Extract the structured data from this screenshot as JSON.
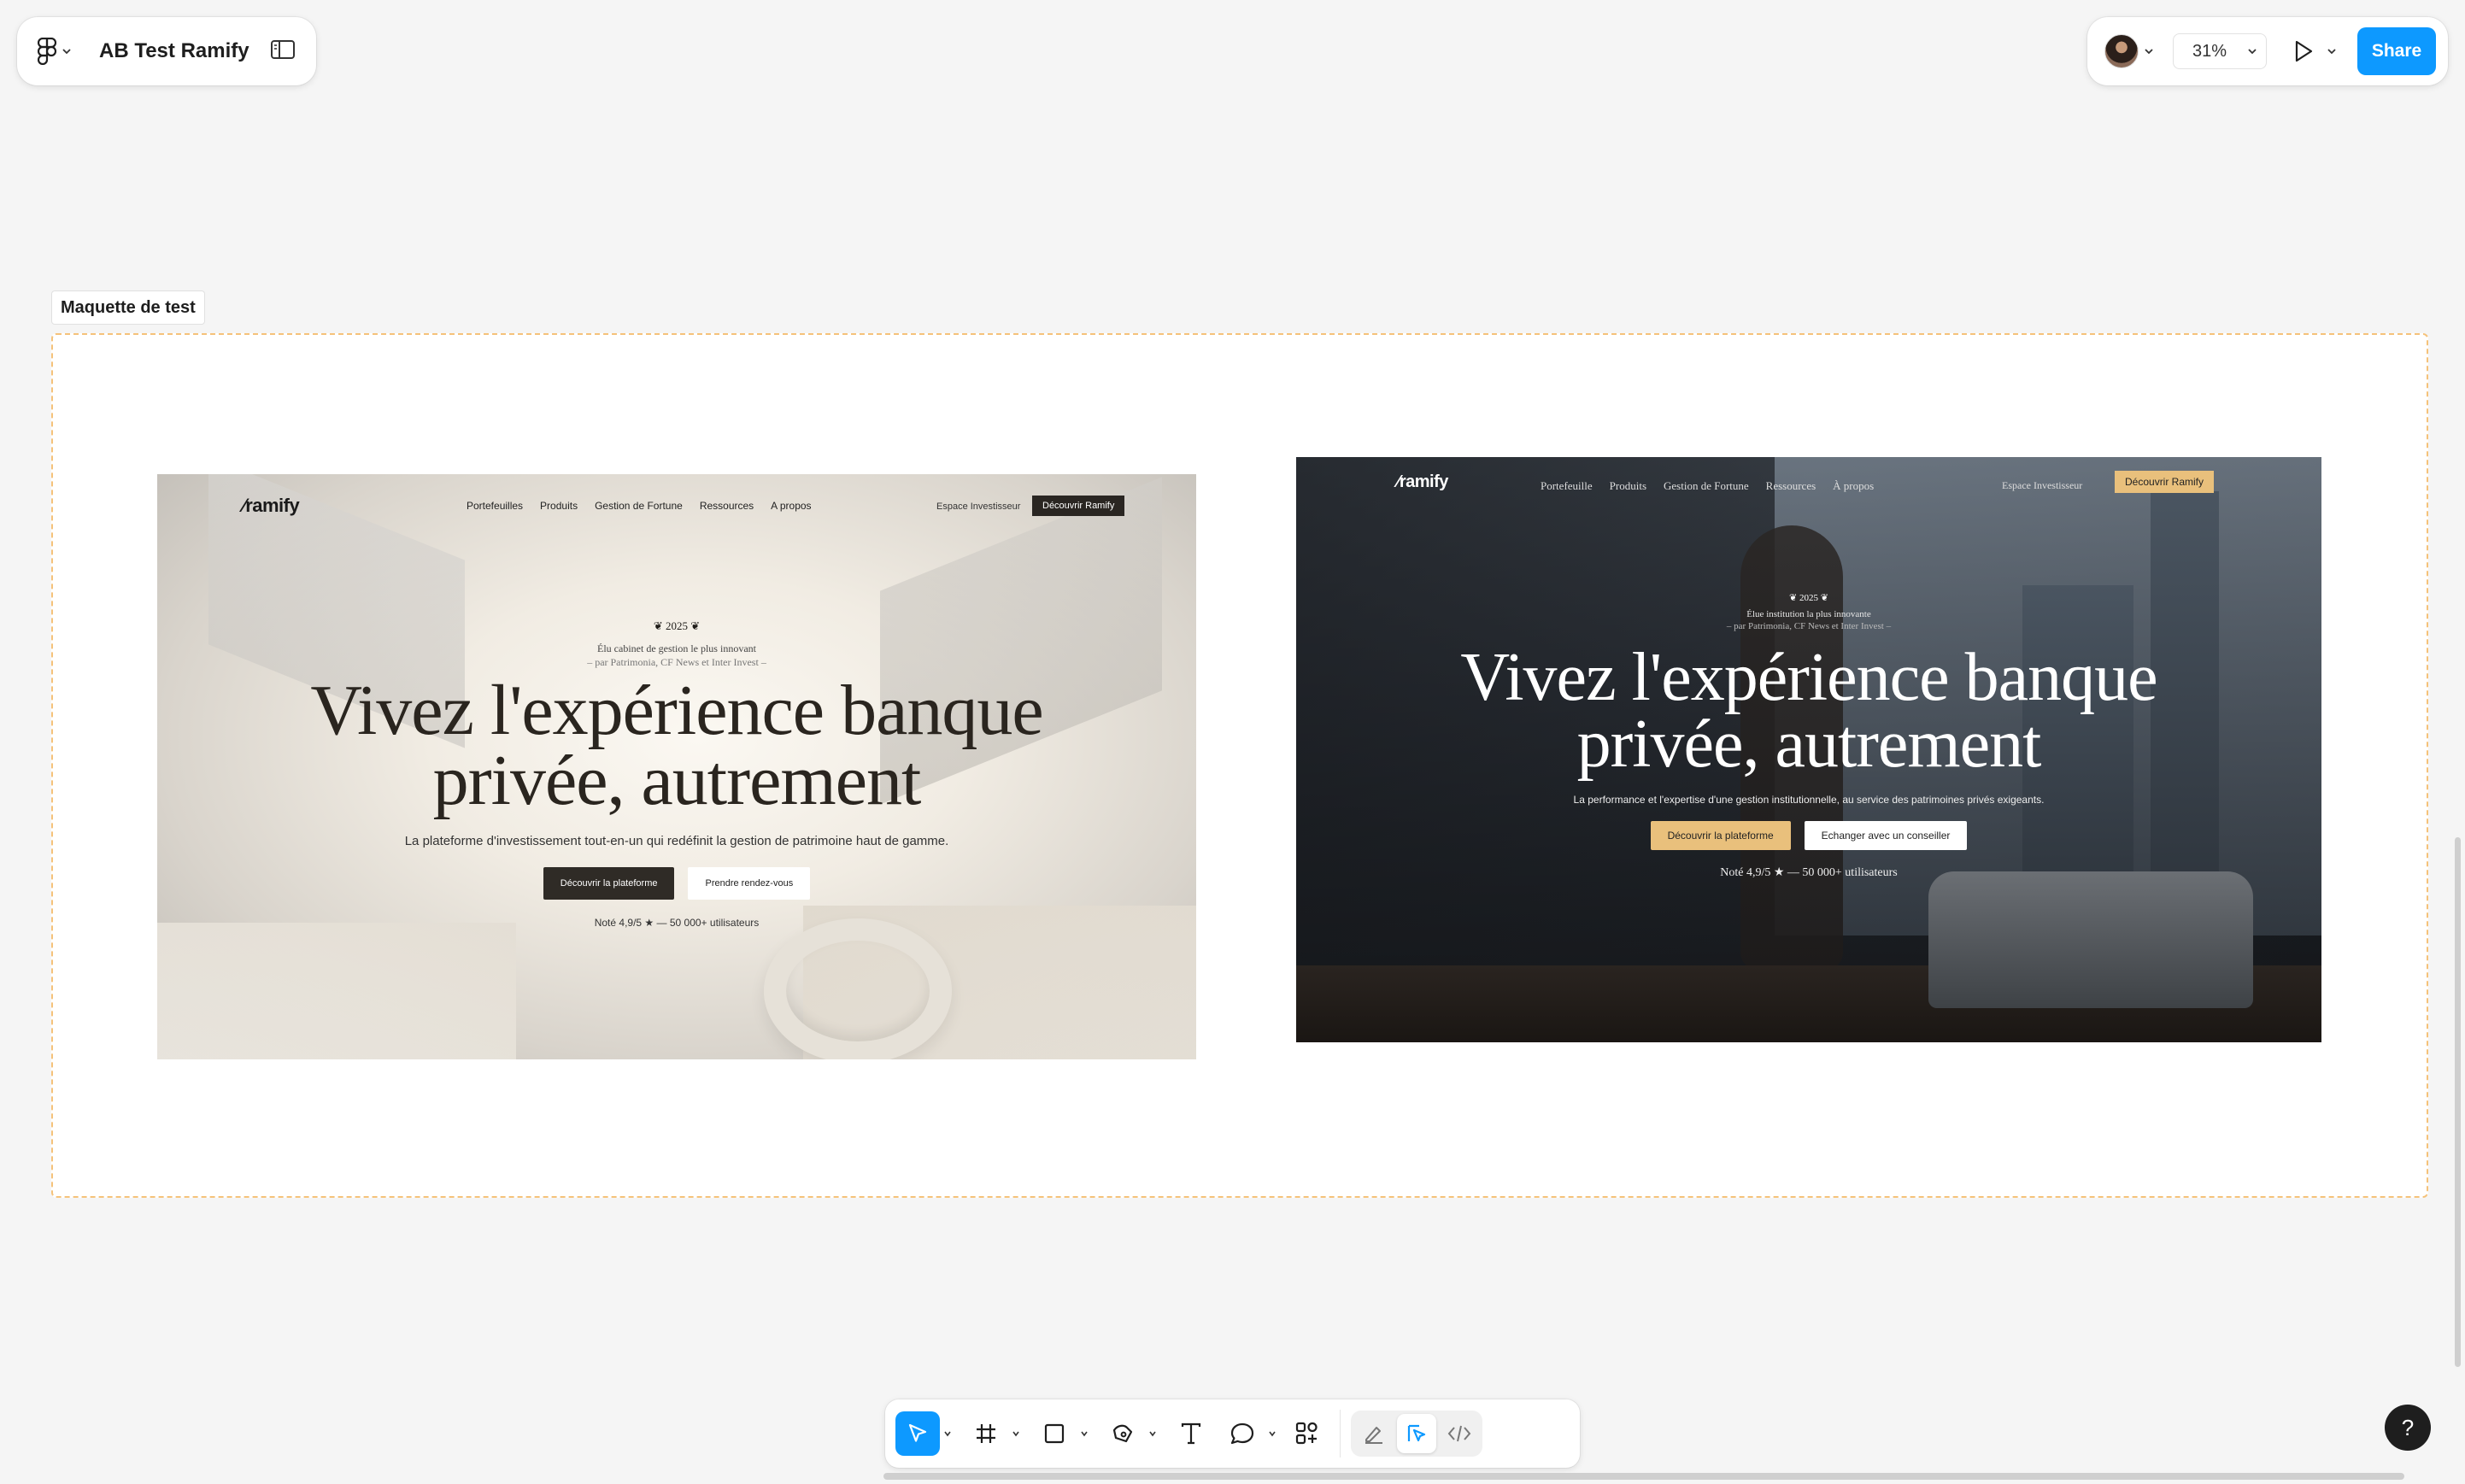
{
  "app": {
    "file_title": "AB Test Ramify",
    "zoom": "31%",
    "share_label": "Share",
    "help_label": "?",
    "accent": "#0d99ff"
  },
  "canvas": {
    "frame_label": "Maquette de test"
  },
  "mockup_a": {
    "brand": "ramify",
    "nav": [
      "Portefeuilles",
      "Produits",
      "Gestion de Fortune",
      "Ressources",
      "A propos"
    ],
    "espace": "Espace Investisseur",
    "cta": "Découvrir Ramify",
    "year": "2025",
    "award_line1": "Élu cabinet de gestion le plus innovant",
    "award_line2": "– par Patrimonia, CF News et Inter Invest –",
    "headline_1": "Vivez l'expérience banque",
    "headline_2": "privée, autrement",
    "subtitle": "La plateforme d'investissement tout-en-un qui redéfinit la gestion de patrimoine haut de gamme.",
    "btn_primary": "Découvrir la plateforme",
    "btn_secondary": "Prendre rendez-vous",
    "rating": "Noté 4,9/5 ★ — 50 000+ utilisateurs"
  },
  "mockup_b": {
    "brand": "ramify",
    "nav": [
      "Portefeuille",
      "Produits",
      "Gestion de Fortune",
      "Ressources",
      "À propos"
    ],
    "espace": "Espace Investisseur",
    "cta": "Découvrir Ramify",
    "year": "2025",
    "award_line1": "Élue institution la plus innovante",
    "award_line2": "– par Patrimonia, CF News et Inter Invest –",
    "headline_1": "Vivez l'expérience banque",
    "headline_2": "privée, autrement",
    "subtitle": "La performance et l'expertise d'une gestion institutionnelle, au service des patrimoines privés exigeants.",
    "btn_primary": "Découvrir la plateforme",
    "btn_secondary": "Echanger avec un conseiller",
    "rating": "Noté 4,9/5 ★ — 50 000+ utilisateurs",
    "gold": "#e9c07c"
  },
  "toolbar": {
    "tools": [
      "move-icon",
      "frame-icon",
      "rectangle-icon",
      "pen-icon",
      "text-icon",
      "comment-icon",
      "actions-icon"
    ],
    "dev": [
      "draw-mode-icon",
      "design-mode-icon",
      "dev-mode-icon"
    ]
  }
}
